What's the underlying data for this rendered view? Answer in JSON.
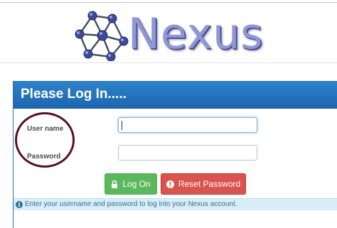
{
  "header": {
    "brand": "Nexus"
  },
  "login": {
    "title": "Please Log In.....",
    "username_label": "User name",
    "password_label": "Password",
    "username_value": "",
    "password_value": "",
    "logon_label": "Log On",
    "reset_label": "Reset Password",
    "info_text": "Enter your username and password to log into your Nexus account."
  },
  "icons": {
    "logo": "molecule-network-icon",
    "logon": "lock-icon",
    "reset": "exclamation-circle-icon",
    "info": "info-icon"
  },
  "colors": {
    "panel_header": "#1f6cb4",
    "logon_button": "#5cb85c",
    "reset_button": "#d9534f",
    "info_bar": "#d9edf7",
    "annotation_circle": "#5a1020",
    "brand_text": "#8f97d6"
  }
}
